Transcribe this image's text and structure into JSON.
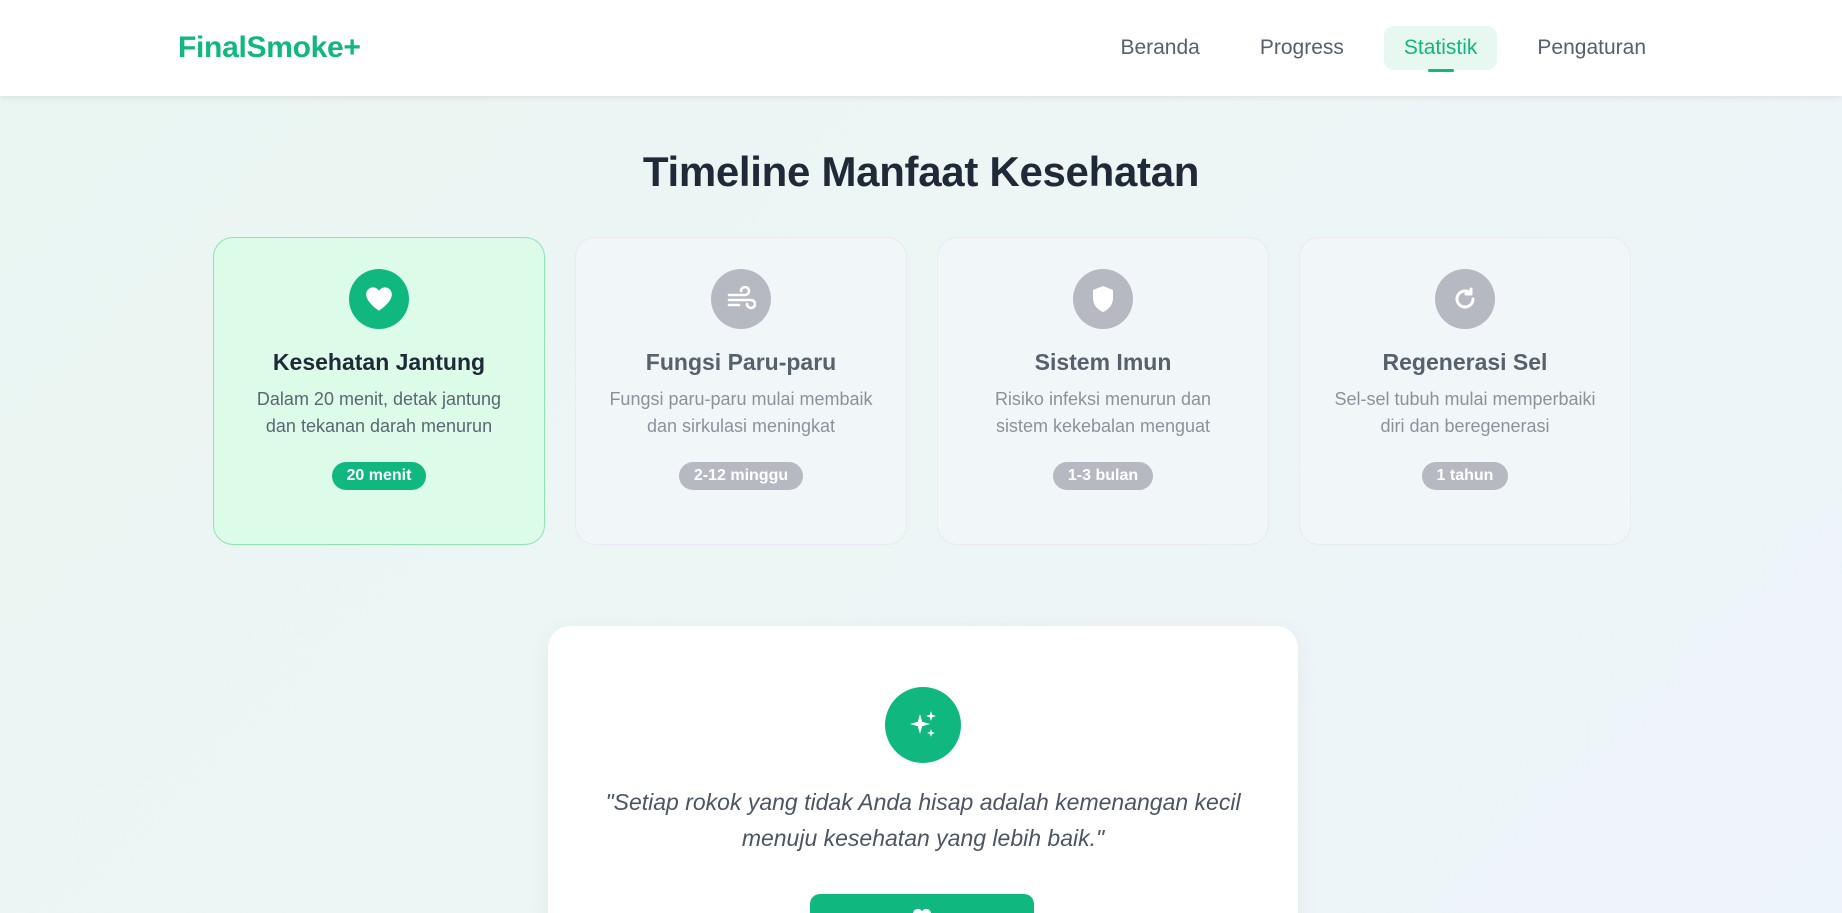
{
  "header": {
    "brand": "FinalSmoke+",
    "nav": [
      {
        "label": "Beranda",
        "active": false
      },
      {
        "label": "Progress",
        "active": false
      },
      {
        "label": "Statistik",
        "active": true
      },
      {
        "label": "Pengaturan",
        "active": false
      }
    ]
  },
  "main": {
    "title": "Timeline Manfaat Kesehatan",
    "cards": [
      {
        "icon": "heart-icon",
        "title": "Kesehatan Jantung",
        "description": "Dalam 20 menit, detak jantung dan tekanan darah menurun",
        "badge": "20 menit",
        "active": true
      },
      {
        "icon": "wind-icon",
        "title": "Fungsi Paru-paru",
        "description": "Fungsi paru-paru mulai membaik dan sirkulasi meningkat",
        "badge": "2-12 minggu",
        "active": false
      },
      {
        "icon": "shield-icon",
        "title": "Sistem Imun",
        "description": "Risiko infeksi menurun dan sistem kekebalan menguat",
        "badge": "1-3 bulan",
        "active": false
      },
      {
        "icon": "refresh-icon",
        "title": "Regenerasi Sel",
        "description": "Sel-sel tubuh mulai memperbaiki diri dan beregenerasi",
        "badge": "1 tahun",
        "active": false
      }
    ],
    "quote": {
      "icon": "sparkles-icon",
      "text": "\"Setiap rokok yang tidak Anda hisap adalah kemenangan kecil menuju kesehatan yang lebih baik.\""
    }
  },
  "colors": {
    "accent": "#10b77f",
    "inactive_icon": "#b6b9c2",
    "active_card_bg": "#dcfbe8",
    "title_text": "#1f2937"
  }
}
